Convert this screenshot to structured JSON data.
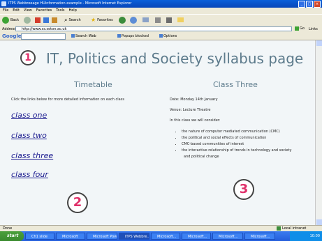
{
  "window": {
    "title": "ITPS Webbreeage HUinformation example - Microsoft Internet Explorer"
  },
  "menu": [
    "File",
    "Edit",
    "View",
    "Favorites",
    "Tools",
    "Help"
  ],
  "toolbar": {
    "back": "Back",
    "search": "Search",
    "favorites": "Favorites"
  },
  "address": {
    "label": "Address",
    "value": "http://www.ss.soton.ac.uk",
    "go": "Go",
    "links": "Links"
  },
  "google_bar": {
    "logo": "Google",
    "items": [
      "Search Web",
      "Popups blocked",
      "Options"
    ]
  },
  "page": {
    "title": "IT, Politics and Society syllabus page",
    "timetable_heading": "Timetable",
    "timetable_note": "Click the links below for more detailed information on each class",
    "class_links": [
      "class one",
      "class two",
      "class three",
      "class four"
    ],
    "class_heading": "Class Three",
    "class_lines": [
      "Date: Monday 14th January",
      "Venue: Lecture Theatre",
      "In this class we will consider:"
    ],
    "bullets": [
      "the nature of computer mediated communication (CMC)",
      "the political and social effects of communication",
      "CMC-based communities of interest",
      "the interactive relationship of trends in technology and society",
      "and political change"
    ],
    "markers": [
      "1",
      "2",
      "3"
    ]
  },
  "status": {
    "text": "Done",
    "zone": "Local intranet"
  },
  "taskbar": {
    "start": "start",
    "tasks": [
      "Ch1 slide",
      "Microsoft",
      "Microsoft Pow...",
      "ITPS Webbre...",
      "Microsoft...",
      "Microsoft...",
      "Microsoft...",
      "Microsoft..."
    ],
    "clock": "10:00"
  }
}
